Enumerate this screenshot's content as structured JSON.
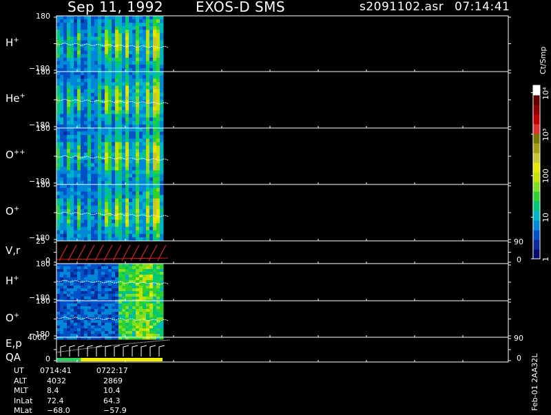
{
  "header": {
    "date": "Sep 11, 1992",
    "instrument": "EXOS-D SMS",
    "file": "s2091102.asr",
    "time": "07:14:41"
  },
  "chart_data": {
    "type": "heatmap",
    "panels": [
      {
        "label": "H",
        "sup": "+",
        "ymax": "180",
        "ymin": "−180",
        "kind": "angle"
      },
      {
        "label": "He",
        "sup": "+",
        "ymax": "180",
        "ymin": "−180",
        "kind": "angle"
      },
      {
        "label": "O",
        "sup": "++",
        "ymax": "180",
        "ymin": "−180",
        "kind": "angle"
      },
      {
        "label": "O",
        "sup": "+",
        "ymax": "180",
        "ymin": "−180",
        "kind": "angle"
      },
      {
        "label": "V,r",
        "sup": "",
        "ymax": "25",
        "ymin": "0",
        "right_top": "90",
        "right_bottom": "0",
        "kind": "line"
      },
      {
        "label": "H",
        "sup": "+",
        "ymax": "180",
        "ymin": "−180",
        "kind": "angle"
      },
      {
        "label": "O",
        "sup": "+",
        "ymax": "180",
        "ymin": "−180",
        "kind": "angle"
      },
      {
        "label": "E,p",
        "label2": "QA",
        "sup": "",
        "ymax": "4000",
        "ymin": "0",
        "right_top": "90",
        "right_bottom": "0",
        "kind": "line"
      }
    ],
    "colorbar": {
      "unit": "Ct/Smp",
      "ticks": [
        {
          "value": 1,
          "label": "1"
        },
        {
          "value": 10,
          "label": "10"
        },
        {
          "value": 100,
          "label": "100"
        },
        {
          "value": 1000,
          "label": "10³"
        },
        {
          "value": 10000,
          "label": "10⁴"
        }
      ],
      "colors": [
        "#0a0a6e",
        "#0b2a9a",
        "#0050c8",
        "#0088d8",
        "#00b4c8",
        "#00c878",
        "#30d030",
        "#80e020",
        "#c8e000",
        "#e6e600",
        "#c8c832",
        "#a0a014",
        "#787800",
        "#e03030",
        "#c00000",
        "#900000",
        "#600000",
        "#ffffff"
      ]
    },
    "qa_segments": [
      {
        "from": 0,
        "to": 0.23,
        "color": "#30d060"
      },
      {
        "from": 0.23,
        "to": 1,
        "color": "#f0f000"
      }
    ]
  },
  "orbit_table": {
    "rows": [
      {
        "name": "UT",
        "v1": "0714:41",
        "v2": "0722:17"
      },
      {
        "name": "ALT",
        "v1": "4032",
        "v2": "2869"
      },
      {
        "name": "MLT",
        "v1": "8.4",
        "v2": "10.4"
      },
      {
        "name": "InLat",
        "v1": "72.4",
        "v2": "64.3"
      },
      {
        "name": "MLat",
        "v1": "−68.0",
        "v2": "−57.9"
      }
    ]
  },
  "footer_code": "Feb-01 2AA32L"
}
